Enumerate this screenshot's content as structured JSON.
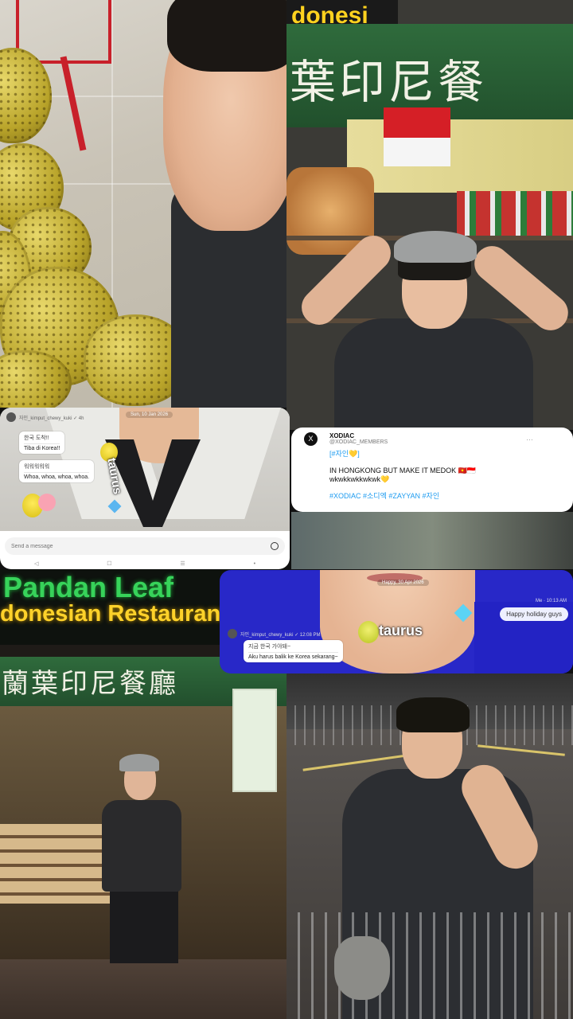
{
  "chat1": {
    "header_user": "자인_kimput_chewy_kuki ✓ 4h",
    "date": "Sun, 10 Jan 2026",
    "bubble1_ko": "한국 도착!!",
    "bubble1_tr": "Tiba di Korea!!",
    "bubble2_ko": "워워워워워",
    "bubble2_tr": "Whoa, whoa, whoa, whoa.",
    "sticker_text": "taurus",
    "input_placeholder": "Send a message",
    "nav": [
      "◁",
      "☐",
      "☰",
      "•"
    ]
  },
  "tweet": {
    "avatar": "X",
    "name": "XODIAC",
    "handle": "@XODIAC_MEMBERS",
    "line1": "[#자인💛]",
    "line2": "IN HONGKONG BUT MAKE IT MEDOK 🇻🇳🇮🇩",
    "line3": "wkwkkwkkwkwk💛",
    "hashtags": "#XODIAC #소디엑 #ZAYYAN #자인",
    "more": "…"
  },
  "signs": {
    "top_right_yellow": "donesi",
    "top_right_chars": "葉印尼餐",
    "pandan": "Pandan Leaf",
    "restaurant": "donesian Restaurant",
    "chars_bottom": "蘭葉印尼餐廳"
  },
  "chat2": {
    "date": "Happy, 30 Apr 2026",
    "header_user": "자인_kimput_chewy_kuki ✓ 12:08 PM",
    "bubble_ko": "지금 한국 가야돼~",
    "bubble_tr": "Aku harus balik ke Korea sekarang~",
    "me_time": "Me · 10:13 AM",
    "me_message": "Happy holiday guys",
    "sticker_text": "taurus"
  }
}
